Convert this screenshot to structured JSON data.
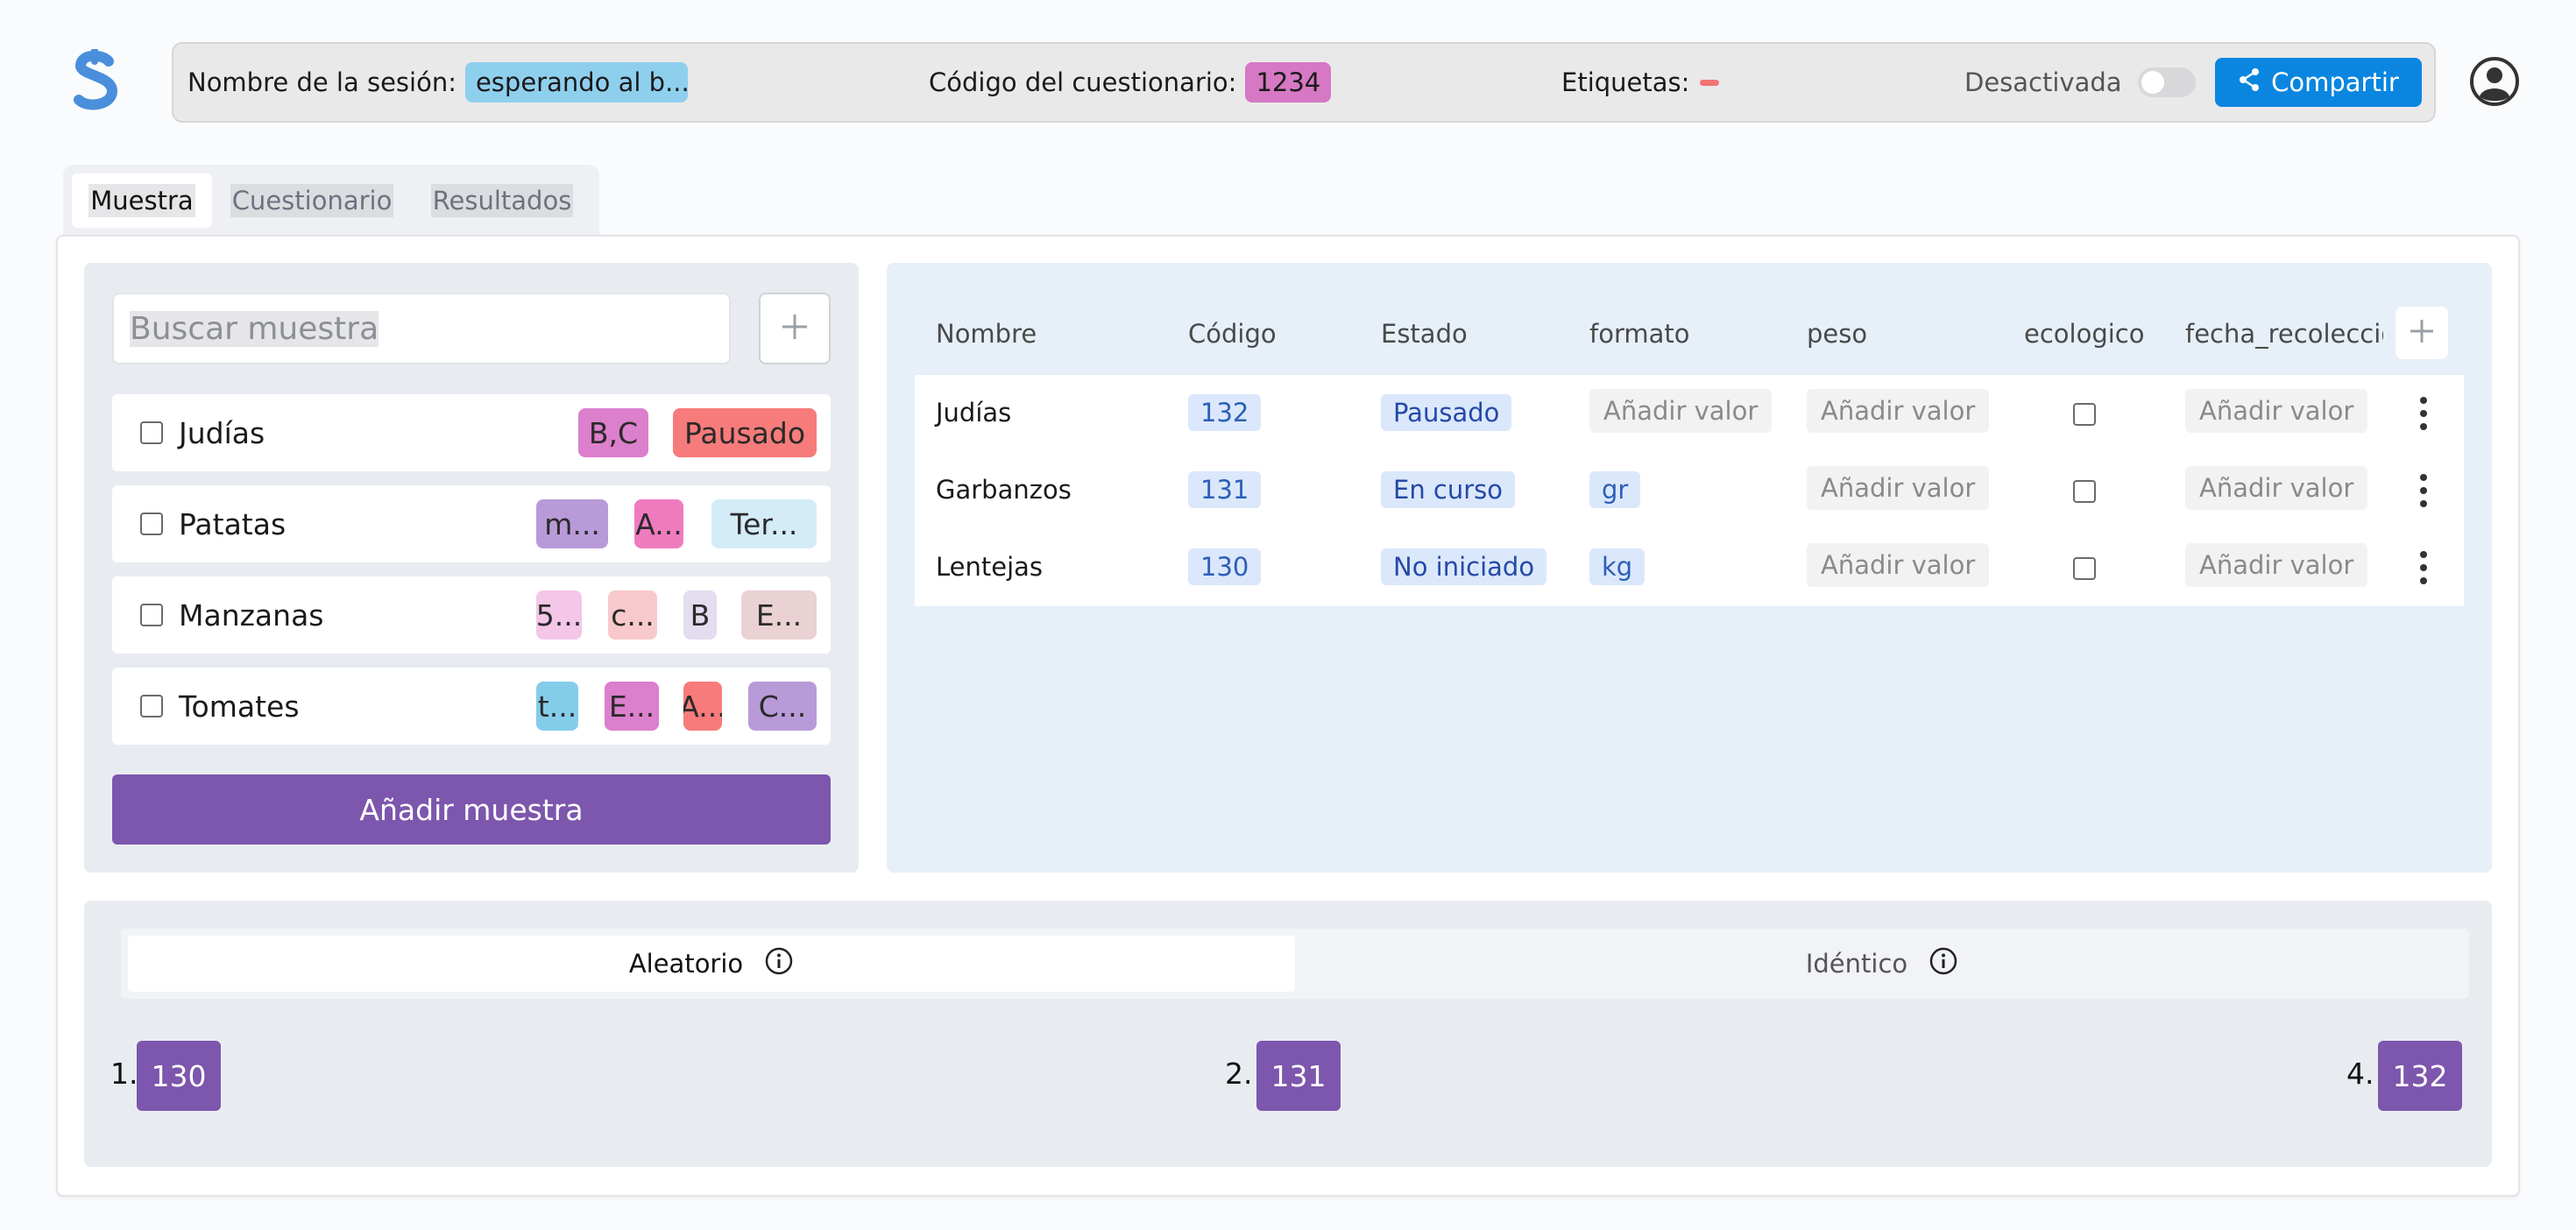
{
  "colors": {
    "brand": "#4a8fdc",
    "session_chip": "#8fcfee",
    "code_chip": "#d678c4",
    "tag_dash": "#f07474",
    "share": "#0a86e0",
    "purple": "#7d56ad"
  },
  "header": {
    "logo_icon": "s-logo-icon",
    "session_label": "Nombre de la sesión:",
    "session_value": "esperando al b...",
    "quiz_code_label": "Código del cuestionario:",
    "quiz_code_value": "1234",
    "tags_label": "Etiquetas:",
    "status_label": "Desactivada",
    "share_label": "Compartir",
    "share_icon": "share-icon",
    "account_icon": "user-circle-icon"
  },
  "tabs": [
    {
      "label": "Muestra",
      "active": true
    },
    {
      "label": "Cuestionario",
      "active": false
    },
    {
      "label": "Resultados",
      "active": false
    }
  ],
  "samples": {
    "search_placeholder": "Buscar muestra",
    "add_icon": "plus-icon",
    "add_button": "Añadir muestra",
    "items": [
      {
        "name": "Judías",
        "tags": [
          {
            "text": "B,C",
            "color": "#dc7fcc"
          },
          {
            "text": "Pausado",
            "color": "#f77b7b"
          }
        ]
      },
      {
        "name": "Patatas",
        "tags": [
          {
            "text": "m...",
            "color": "#b89ad8"
          },
          {
            "text": "A...",
            "color": "#ef7bbf"
          },
          {
            "text": "Ter...",
            "color": "#d4ecf8"
          }
        ]
      },
      {
        "name": "Manzanas",
        "tags": [
          {
            "text": "5...",
            "color": "#f4c6e8"
          },
          {
            "text": "c...",
            "color": "#f8c9cc"
          },
          {
            "text": "B",
            "color": "#e4dcef"
          },
          {
            "text": "E...",
            "color": "#ead1d3"
          }
        ]
      },
      {
        "name": "Tomates",
        "tags": [
          {
            "text": "t...",
            "color": "#84cdea"
          },
          {
            "text": "E...",
            "color": "#dc7fcc"
          },
          {
            "text": "A...",
            "color": "#f77b7b"
          },
          {
            "text": "C...",
            "color": "#b89ad8"
          }
        ]
      }
    ]
  },
  "table": {
    "headers": [
      "Nombre",
      "Código",
      "Estado",
      "formato",
      "peso",
      "ecologico",
      "fecha_recoleccion"
    ],
    "empty_value": "Añadir valor",
    "rows": [
      {
        "name": "Judías",
        "code": "132",
        "state": "Pausado",
        "format": "",
        "weight": "",
        "eco": false,
        "date": ""
      },
      {
        "name": "Garbanzos",
        "code": "131",
        "state": "En curso",
        "format": "gr",
        "weight": "",
        "eco": false,
        "date": ""
      },
      {
        "name": "Lentejas",
        "code": "130",
        "state": "No iniciado",
        "format": "kg",
        "weight": "",
        "eco": false,
        "date": ""
      }
    ],
    "row_menu_icon": "more-vertical-icon",
    "add_column_icon": "plus-icon"
  },
  "order": {
    "mode_random": "Aleatorio",
    "mode_identical": "Idéntico",
    "info_icon": "info-icon",
    "items": [
      {
        "index": "1.",
        "code": "130"
      },
      {
        "index": "2.",
        "code": "131"
      },
      {
        "index": "4.",
        "code": "132"
      }
    ]
  }
}
